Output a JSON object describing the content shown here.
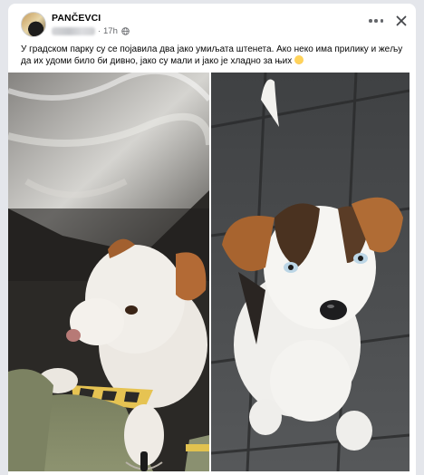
{
  "post": {
    "page_name": "PANČEVCI",
    "separator": "·",
    "timestamp": "17h",
    "text": "У градском парку су се појавила два јако умиљата штенета. Ако неко има прилику и жељу да их удоми било би дивно, јако су мали и јако је хладно за њих",
    "emoji": "crying-face-emoji"
  },
  "icons": {
    "privacy": "globe-icon",
    "more": "more-options-icon",
    "close": "close-icon"
  },
  "photos": [
    {
      "name": "puppy-photo-left"
    },
    {
      "name": "puppy-photo-right"
    }
  ],
  "colors": {
    "background": "#e4e6eb",
    "card": "#ffffff",
    "text_primary": "#050505",
    "text_secondary": "#65676b"
  }
}
